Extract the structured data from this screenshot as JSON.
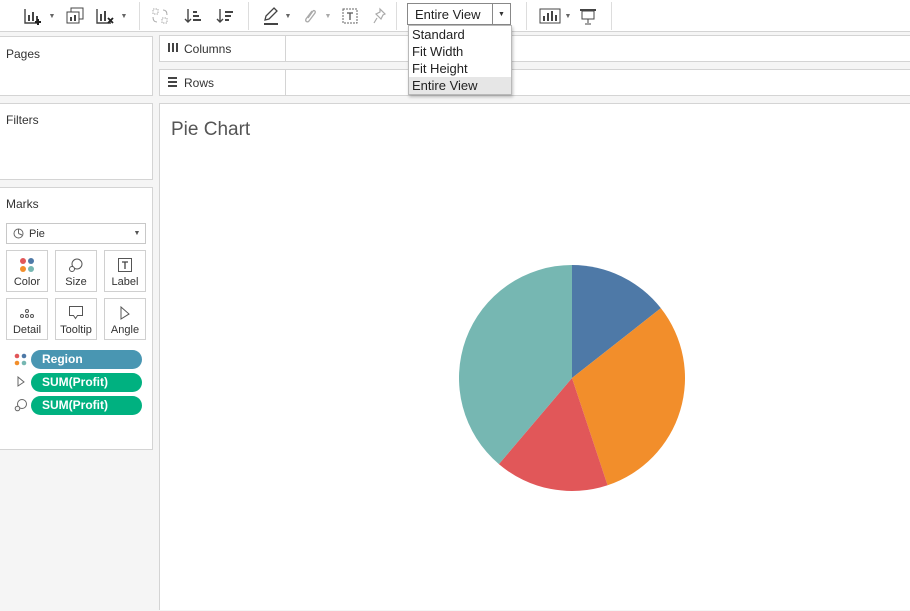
{
  "toolbar": {
    "icons": [
      "new-worksheet-icon",
      "duplicate-sheet-icon",
      "clear-sheet-icon",
      "swap-icon",
      "sort-ascending-icon",
      "sort-descending-icon",
      "highlight-icon",
      "group-icon",
      "label-toggle-icon",
      "pin-icon",
      "show-me-icon",
      "presentation-icon"
    ],
    "fit_value": "Entire View",
    "fit_options": [
      "Standard",
      "Fit Width",
      "Fit Height",
      "Entire View"
    ]
  },
  "cards": {
    "pages": "Pages",
    "filters": "Filters",
    "marks": "Marks",
    "mark_type": "Pie",
    "mark_buttons": [
      "Color",
      "Size",
      "Label",
      "Detail",
      "Tooltip",
      "Angle"
    ]
  },
  "shelves": {
    "columns": "Columns",
    "rows": "Rows"
  },
  "pills": [
    {
      "label": "Region",
      "color": "#4996b2",
      "icon": "color-dots-icon"
    },
    {
      "label": "SUM(Profit)",
      "color": "#00b180",
      "icon": "angle-icon"
    },
    {
      "label": "SUM(Profit)",
      "color": "#00b180",
      "icon": "size-icon"
    }
  ],
  "view": {
    "title": "Pie Chart"
  },
  "chart_data": {
    "type": "pie",
    "title": "Pie Chart",
    "slices": [
      {
        "fraction": 0.144,
        "color": "#4e79a7"
      },
      {
        "fraction": 0.305,
        "color": "#f28e2b"
      },
      {
        "fraction": 0.163,
        "color": "#e15759"
      },
      {
        "fraction": 0.388,
        "color": "#76b7b2"
      }
    ],
    "legend": "none",
    "grid": false
  }
}
